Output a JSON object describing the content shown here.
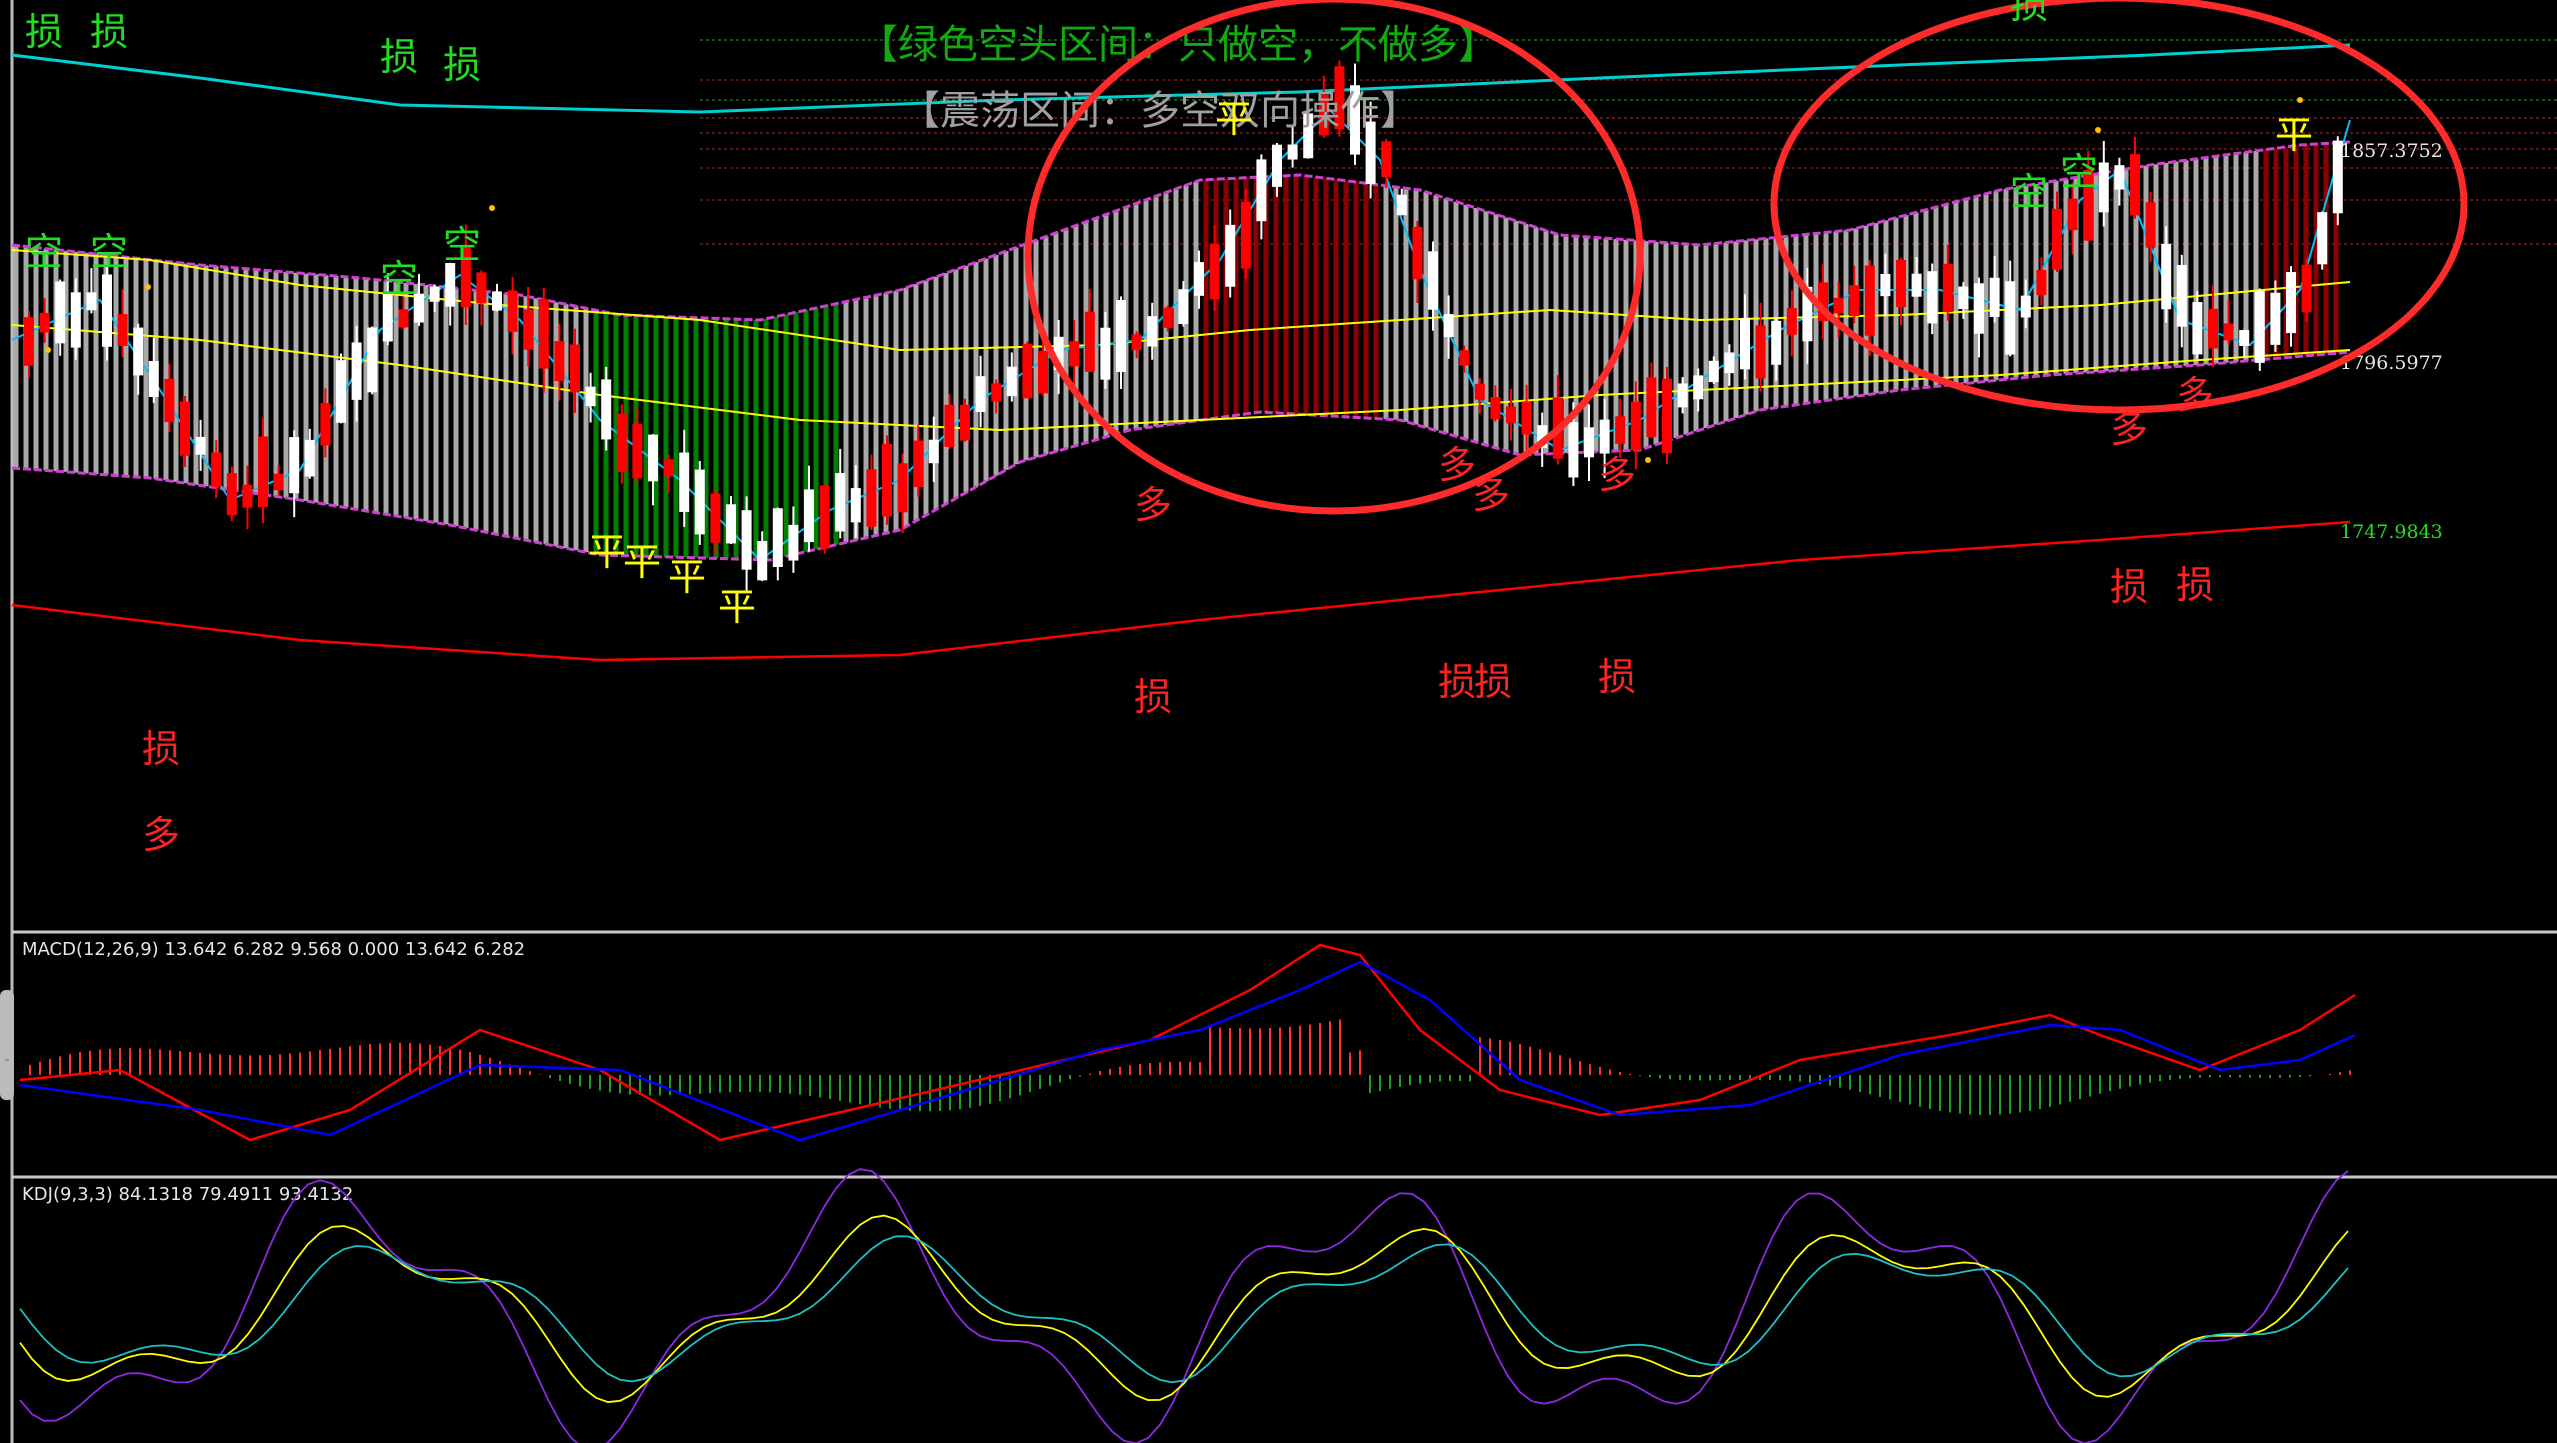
{
  "banners": {
    "green_zone": "【绿色空头区间：只做空，不做多】",
    "range_zone": "【震荡区间：多空双向操作】"
  },
  "price_labels": {
    "upper": "1857.3752",
    "lower": "1796.5977",
    "long_ma": "1747.9843"
  },
  "macd": {
    "label": "MACD(12,26,9) 13.642 6.282 9.568 0.000 13.642 6.282",
    "values": [
      13.642,
      6.282,
      9.568,
      0.0,
      13.642,
      6.282
    ]
  },
  "kdj": {
    "label": "KDJ(9,3,3) 84.1318 79.4911 93.4132",
    "values": [
      84.1318,
      79.4911,
      93.4132
    ]
  },
  "signals": {
    "stop": "损",
    "short": "空",
    "long": "多",
    "flat": "平"
  },
  "colors": {
    "background": "#000000",
    "bull_candle": "#ff0000",
    "bear_candle": "#ffffff",
    "band_fill_gray": "#a8a8a8",
    "band_fill_green": "#008000",
    "band_fill_red": "#8b0000",
    "band_edge": "#d040d0",
    "ma_fast": "#00bfff",
    "ma_slow": "#ffff00",
    "ma_long_top": "#00d0d0",
    "ma_long_bottom": "#ff0000",
    "signal_stop_green": "#22dd22",
    "signal_stop_red": "#ff2222",
    "signal_flat": "#ffff00",
    "highlight_circle": "#ff2a2a",
    "macd_line": "#ff0000",
    "macd_signal": "#0000ff",
    "macd_turn": "#ffff00",
    "macd_turn2": "#c0ffff",
    "kdj_k": "#ffff00",
    "kdj_d": "#20c0c0",
    "kdj_j": "#8a2be2",
    "panel_separator": "#c8c8c8"
  },
  "chart_data": {
    "type": "candlestick",
    "panels": [
      "price",
      "MACD(12,26,9)",
      "KDJ(9,3,3)"
    ],
    "price_levels": [
      1857.3752,
      1796.5977,
      1747.9843
    ],
    "macd": {
      "dif": 13.642,
      "dea": 6.282,
      "macd": 9.568
    },
    "kdj": {
      "k": 84.1318,
      "d": 79.4911,
      "j": 93.4132
    }
  }
}
